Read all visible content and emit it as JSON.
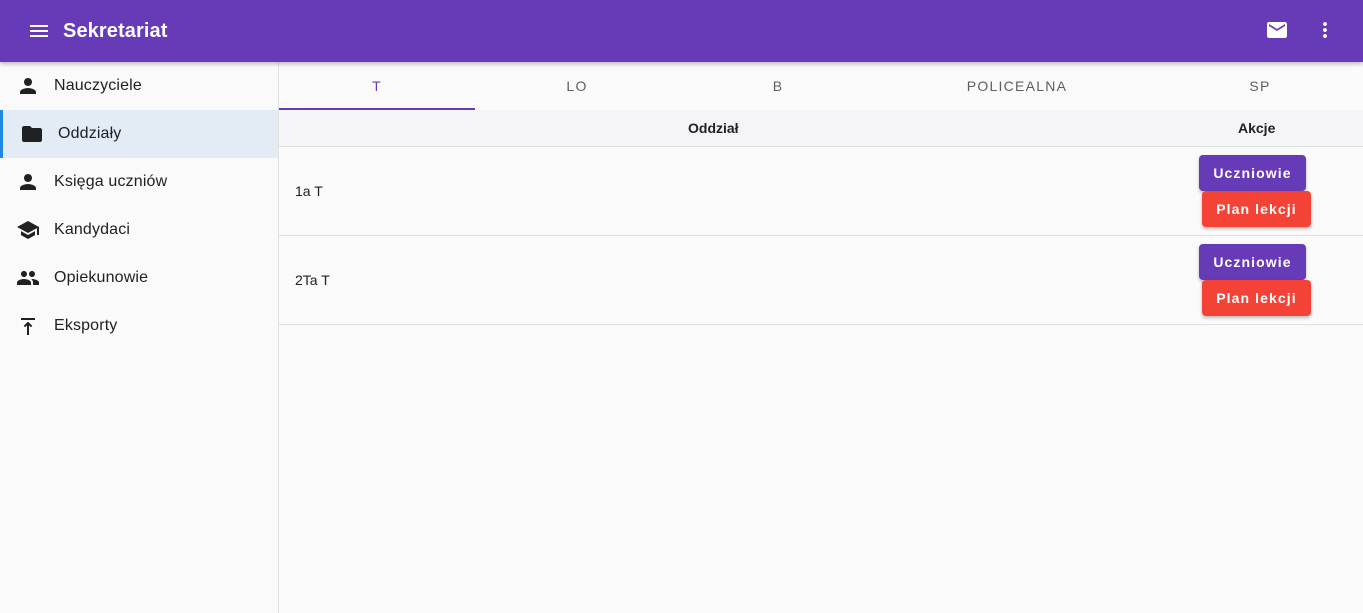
{
  "appbar": {
    "title": "Sekretariat",
    "icons": [
      "menu-icon",
      "mail-icon",
      "more-vert-icon"
    ],
    "color": "#673ab7"
  },
  "sidebar": {
    "items": [
      {
        "label": "Nauczyciele",
        "icon": "person-icon",
        "active": false
      },
      {
        "label": "Oddziały",
        "icon": "folder-icon",
        "active": true
      },
      {
        "label": "Księga uczniów",
        "icon": "person-icon",
        "active": false
      },
      {
        "label": "Kandydaci",
        "icon": "school-icon",
        "active": false
      },
      {
        "label": "Opiekunowie",
        "icon": "people-icon",
        "active": false
      },
      {
        "label": "Eksporty",
        "icon": "upload-icon",
        "active": false
      }
    ],
    "active_color": "#1e88e5"
  },
  "tabs": [
    {
      "label": "T",
      "active": true
    },
    {
      "label": "LO",
      "active": false
    },
    {
      "label": "B",
      "active": false
    },
    {
      "label": "POLICEALNA",
      "active": false
    },
    {
      "label": "SP",
      "active": false
    }
  ],
  "table": {
    "columns": [
      "Oddział",
      "Akcje"
    ],
    "rows": [
      {
        "name": "1a T",
        "actions": [
          "Uczniowie",
          "Plan lekcji"
        ]
      },
      {
        "name": "2Ta T",
        "actions": [
          "Uczniowie",
          "Plan lekcji"
        ]
      }
    ]
  },
  "colors": {
    "primary": "#673ab7",
    "danger": "#f44336"
  }
}
